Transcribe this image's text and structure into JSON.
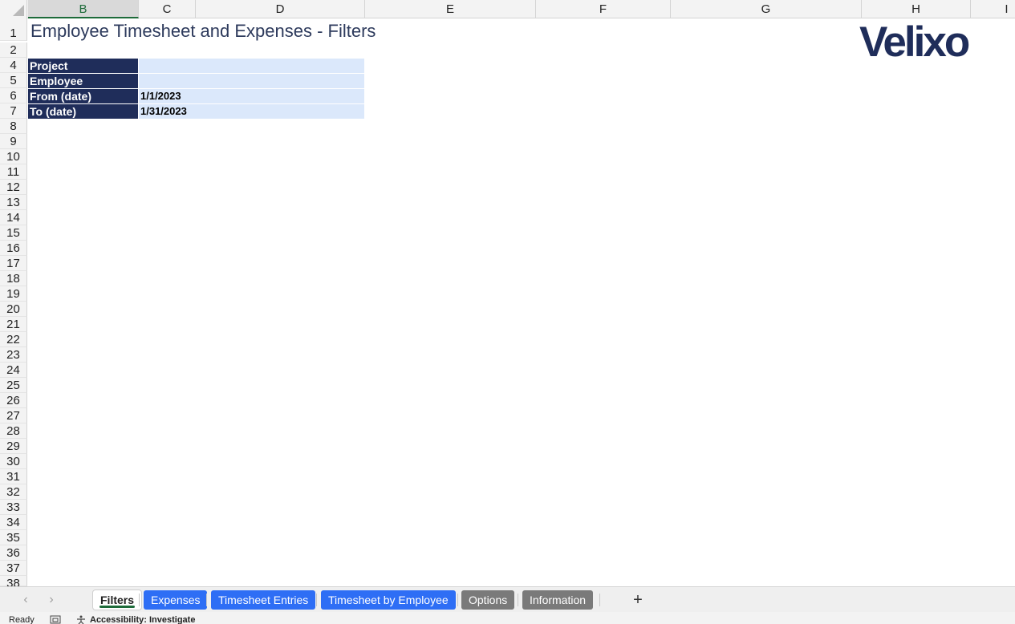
{
  "columns": [
    "B",
    "C",
    "D",
    "E",
    "F",
    "G",
    "H",
    "I"
  ],
  "rows": [
    "1",
    "2",
    "4",
    "5",
    "6",
    "7",
    "8",
    "9",
    "10",
    "11",
    "12",
    "13",
    "14",
    "15",
    "16",
    "17",
    "18",
    "19",
    "20",
    "21",
    "22",
    "23",
    "24",
    "25",
    "26",
    "27",
    "28",
    "29",
    "30",
    "31",
    "32",
    "33",
    "34",
    "35",
    "36",
    "37",
    "38"
  ],
  "sheet": {
    "title": "Employee Timesheet and Expenses - Filters",
    "filters": [
      {
        "label": "Project",
        "value": ""
      },
      {
        "label": "Employee",
        "value": ""
      },
      {
        "label": "From (date)",
        "value": "1/1/2023"
      },
      {
        "label": "To (date)",
        "value": "1/31/2023"
      }
    ]
  },
  "logo": {
    "text": "Velixo",
    "icon": "velixo-logo"
  },
  "tabs": [
    {
      "label": "Filters",
      "style": "active"
    },
    {
      "label": "Expenses",
      "style": "blue"
    },
    {
      "label": "Timesheet Entries",
      "style": "blue"
    },
    {
      "label": "Timesheet by Employee",
      "style": "blue"
    },
    {
      "label": "Options",
      "style": "gray"
    },
    {
      "label": "Information",
      "style": "gray"
    }
  ],
  "tab_nav": {
    "prev_icon": "chevron-left-icon",
    "next_icon": "chevron-right-icon",
    "add_icon": "plus-icon",
    "prev_glyph": "‹",
    "next_glyph": "›",
    "add_glyph": "+"
  },
  "status": {
    "ready": "Ready",
    "accessibility": "Accessibility: Investigate"
  },
  "colors": {
    "label_bg": "#1f2d5a",
    "value_bg": "#dbe8fb",
    "tab_blue": "#2e6ef5",
    "tab_gray": "#7a7a7a"
  }
}
